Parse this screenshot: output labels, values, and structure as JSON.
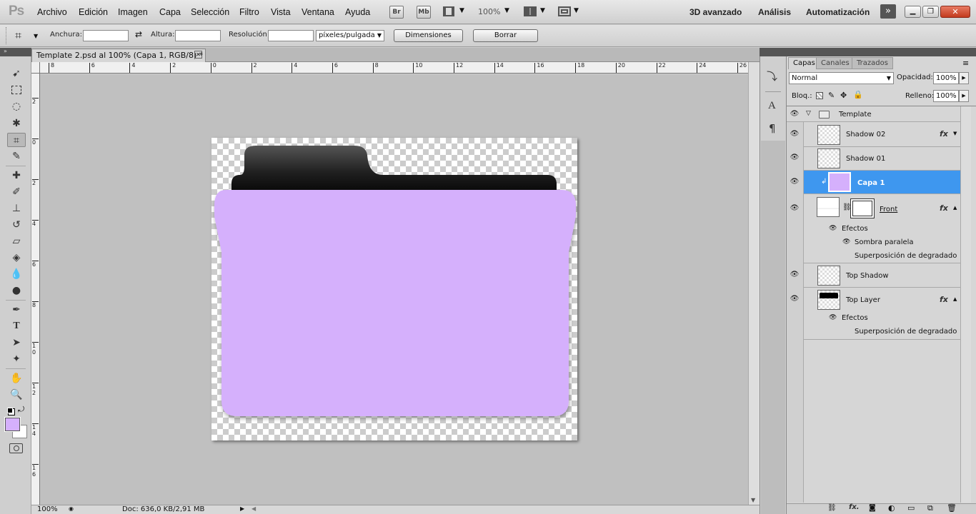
{
  "app": {
    "logo": "Ps"
  },
  "menu": [
    "Archivo",
    "Edición",
    "Imagen",
    "Capa",
    "Selección",
    "Filtro",
    "Vista",
    "Ventana",
    "Ayuda"
  ],
  "appbar": {
    "bridge": "Br",
    "minibridge": "Mb",
    "zoom": "100%"
  },
  "workspaces": [
    "3D avanzado",
    "Análisis",
    "Automatización"
  ],
  "options": {
    "width_label": "Anchura:",
    "width_value": "",
    "height_label": "Altura:",
    "height_value": "",
    "resolution_label": "Resolución:",
    "resolution_value": "",
    "units": "píxeles/pulgada",
    "dimensions_button": "Dimensiones",
    "clear_button": "Borrar"
  },
  "document": {
    "tab_title": "Template 2.psd al 100% (Capa 1, RGB/8) *",
    "zoom": "100%",
    "doc_info": "Doc: 636,0 KB/2,91 MB",
    "ruler_top": [
      "8",
      "6",
      "4",
      "2",
      "0",
      "2",
      "4",
      "6",
      "8",
      "10",
      "12",
      "14",
      "16",
      "18",
      "20",
      "22",
      "24",
      "26"
    ],
    "ruler_left": [
      "2",
      "0",
      "2",
      "4",
      "6",
      "8",
      "1 0",
      "1 2",
      "1 4",
      "1 6"
    ]
  },
  "colors": {
    "foreground": "#d5b0fc",
    "background": "#ffffff",
    "folder_front": "#d5b0fc",
    "folder_back": "#1a1a1a",
    "selection": "#3e97ef"
  },
  "layers_panel": {
    "tabs": [
      "Capas",
      "Canales",
      "Trazados"
    ],
    "blend_mode": "Normal",
    "opacity_label": "Opacidad:",
    "opacity": "100%",
    "lock_label": "Bloq.:",
    "fill_label": "Relleno:",
    "fill": "100%",
    "group": "Template",
    "layers": [
      {
        "name": "Shadow 02",
        "fx": "fx"
      },
      {
        "name": "Shadow 01"
      },
      {
        "name": "Capa 1",
        "selected": true
      },
      {
        "name": "Front",
        "fx": "fx",
        "effects_label": "Efectos",
        "effects": [
          "Sombra paralela",
          "Superposición de degradado"
        ]
      },
      {
        "name": "Top Shadow"
      },
      {
        "name": "Top Layer",
        "fx": "fx",
        "effects_label": "Efectos",
        "effects": [
          "Superposición de degradado"
        ]
      }
    ]
  }
}
